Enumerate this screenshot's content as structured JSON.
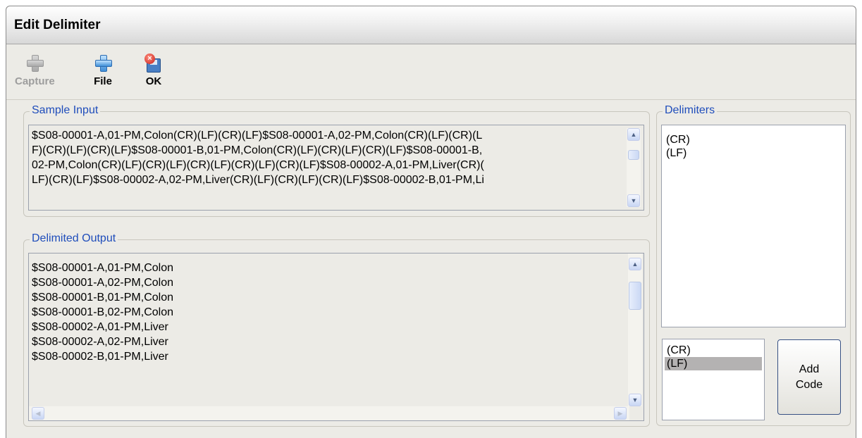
{
  "window": {
    "title": "Edit Delimiter"
  },
  "toolbar": {
    "capture_label": "Capture",
    "file_label": "File",
    "ok_label": "OK"
  },
  "sample_input": {
    "legend": "Sample Input",
    "lines": [
      "$S08-00001-A,01-PM,Colon(CR)(LF)(CR)(LF)$S08-00001-A,02-PM,Colon(CR)(LF)(CR)(L",
      "F)(CR)(LF)(CR)(LF)$S08-00001-B,01-PM,Colon(CR)(LF)(CR)(LF)(CR)(LF)$S08-00001-B,",
      "02-PM,Colon(CR)(LF)(CR)(LF)(CR)(LF)(CR)(LF)(CR)(LF)$S08-00002-A,01-PM,Liver(CR)(",
      "LF)(CR)(LF)$S08-00002-A,02-PM,Liver(CR)(LF)(CR)(LF)(CR)(LF)$S08-00002-B,01-PM,Li"
    ]
  },
  "delimited_output": {
    "legend": "Delimited Output",
    "lines": [
      "$S08-00001-A,01-PM,Colon",
      "$S08-00001-A,02-PM,Colon",
      "$S08-00001-B,01-PM,Colon",
      "$S08-00001-B,02-PM,Colon",
      "$S08-00002-A,01-PM,Liver",
      "$S08-00002-A,02-PM,Liver",
      "$S08-00002-B,01-PM,Liver"
    ]
  },
  "delimiters": {
    "legend": "Delimiters",
    "items": [
      "(CR)",
      "(LF)"
    ]
  },
  "codes": {
    "items": [
      "(CR)",
      "(LF)"
    ],
    "selected": "(LF)",
    "add_code_line1": "Add",
    "add_code_line2": "Code"
  },
  "colors": {
    "legend_text": "#1f4dbb",
    "window_bg": "#ecebe6",
    "selection": "#b4b2b2"
  },
  "icons": {
    "capture": "plus-gray-icon",
    "file": "plus-blue-icon",
    "ok": "save-close-icon"
  }
}
